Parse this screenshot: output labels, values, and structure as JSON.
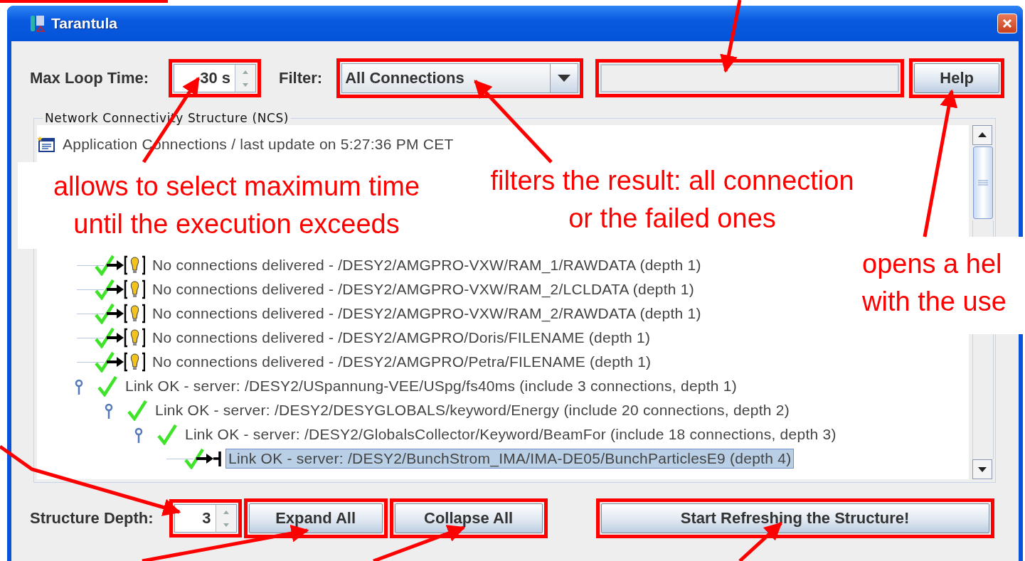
{
  "window": {
    "title": "Tarantula"
  },
  "toolbar": {
    "max_loop_time": {
      "label": "Max Loop Time:",
      "value": "30 s",
      "highlighted": true
    },
    "filter": {
      "label": "Filter:",
      "value": "All Connections",
      "highlighted": true
    },
    "message_field": {
      "highlighted": true
    },
    "help_button": {
      "label": "Help",
      "highlighted": true
    }
  },
  "tree_panel": {
    "title": "Network Connectivity Structure (NCS)",
    "tree": [
      {
        "kind": "root",
        "label": "Application Connections / last update on 5:27:36 PM CET",
        "selected": false,
        "children": [
          {
            "kind": "no-connection",
            "label": "No connections delivered - /DESY2/AMGPRO-VXW/RAM_1/RAWDATA (depth 1)",
            "selected": false
          },
          {
            "kind": "no-connection",
            "label": "No connections delivered - /DESY2/AMGPRO-VXW/RAM_2/LCLDATA (depth 1)",
            "selected": false
          },
          {
            "kind": "no-connection",
            "label": "No connections delivered - /DESY2/AMGPRO-VXW/RAM_2/RAWDATA (depth 1)",
            "selected": false
          },
          {
            "kind": "no-connection",
            "label": "No connections delivered - /DESY2/AMGPRO/Doris/FILENAME (depth 1)",
            "selected": false
          },
          {
            "kind": "no-connection",
            "label": "No connections delivered - /DESY2/AMGPRO/Petra/FILENAME (depth 1)",
            "selected": false
          },
          {
            "kind": "link",
            "label": "Link OK - server: /DESY2/USpannung-VEE/USpg/fs40ms (include 3 connections, depth 1)",
            "selected": false,
            "expanded": true,
            "children": [
              {
                "kind": "link",
                "label": "Link OK - server: /DESY2/DESYGLOBALS/keyword/Energy (include 20 connections, depth 2)",
                "selected": false,
                "expanded": true,
                "children": [
                  {
                    "kind": "link",
                    "label": "Link OK - server: /DESY2/GlobalsCollector/Keyword/BeamFor (include 18 connections, depth 3)",
                    "selected": false,
                    "expanded": true,
                    "children": [
                      {
                        "kind": "terminal",
                        "label": "Link OK - server: /DESY2/BunchStrom_IMA/IMA-DE05/BunchParticlesE9 (depth 4)",
                        "selected": true
                      }
                    ]
                  }
                ]
              }
            ]
          }
        ]
      }
    ]
  },
  "bottom_bar": {
    "structure_depth": {
      "label": "Structure Depth:",
      "value": "3",
      "highlighted": true
    },
    "buttons": [
      {
        "label": "Expand All",
        "highlighted": true
      },
      {
        "label": "Collapse All",
        "highlighted": true
      },
      {
        "label": "Start Refreshing the Structure!",
        "highlighted": true
      }
    ]
  },
  "callouts": [
    {
      "text": "allows to select maximum time\nuntil the execution exceeds"
    },
    {
      "text": "filters the result: all connection\nor the failed ones"
    },
    {
      "text": "opens a hel\nwith the use"
    }
  ]
}
